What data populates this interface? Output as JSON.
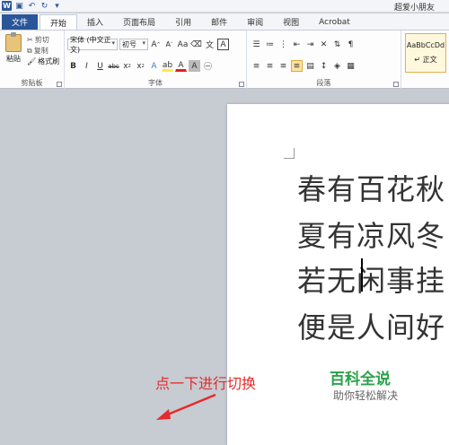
{
  "title_bar": {
    "user": "超爱小朋友"
  },
  "tabs": [
    "文件",
    "开始",
    "插入",
    "页面布局",
    "引用",
    "邮件",
    "审阅",
    "视图",
    "Acrobat"
  ],
  "clipboard": {
    "paste": "粘贴",
    "cut": "剪切",
    "copy": "复制",
    "format_painter": "格式刷",
    "label": "剪贴板"
  },
  "font": {
    "family": "宋体 (中文正文)",
    "size": "初号",
    "label": "字体"
  },
  "paragraph": {
    "label": "段落"
  },
  "styles": {
    "sample": "AaBbCcDd",
    "name": "↵ 正文"
  },
  "document": {
    "lines": [
      "春有百花秋",
      "夏有凉风冬",
      "若无闲事挂",
      "便是人间好"
    ]
  },
  "watermark": {
    "title": "百科全说",
    "subtitle": "助你轻松解决"
  },
  "annotation": "点一下进行切换",
  "colors": {
    "file_tab": "#2a5699",
    "annotation": "#e52b2b",
    "watermark": "#2aa14a"
  }
}
